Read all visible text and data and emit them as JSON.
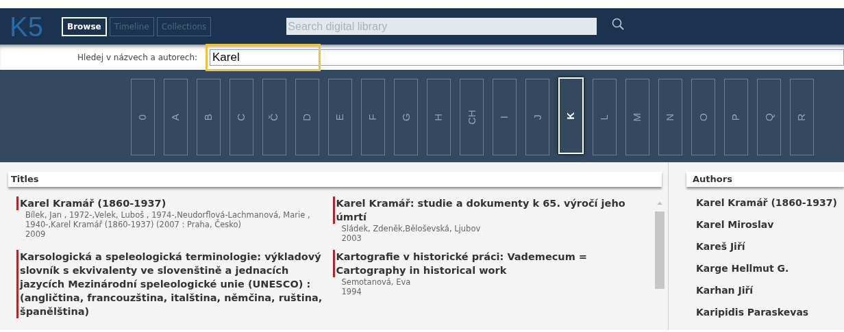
{
  "header": {
    "logo": "K5",
    "tabs": [
      {
        "label": "Browse",
        "selected": true
      },
      {
        "label": "Timeline",
        "selected": false
      },
      {
        "label": "Collections",
        "selected": false
      }
    ],
    "search": {
      "placeholder": "Search digital library"
    }
  },
  "filter": {
    "label": "Hledej v názvech a autorech:",
    "value": "Karel"
  },
  "letters": [
    {
      "label": "0",
      "selected": false
    },
    {
      "label": "A",
      "selected": false
    },
    {
      "label": "B",
      "selected": false
    },
    {
      "label": "C",
      "selected": false
    },
    {
      "label": "Č",
      "selected": false
    },
    {
      "label": "D",
      "selected": false
    },
    {
      "label": "E",
      "selected": false
    },
    {
      "label": "F",
      "selected": false
    },
    {
      "label": "G",
      "selected": false
    },
    {
      "label": "H",
      "selected": false
    },
    {
      "label": "CH",
      "selected": false
    },
    {
      "label": "I",
      "selected": false
    },
    {
      "label": "J",
      "selected": false
    },
    {
      "label": "K",
      "selected": true
    },
    {
      "label": "L",
      "selected": false
    },
    {
      "label": "M",
      "selected": false
    },
    {
      "label": "N",
      "selected": false
    },
    {
      "label": "O",
      "selected": false
    },
    {
      "label": "P",
      "selected": false
    },
    {
      "label": "Q",
      "selected": false
    },
    {
      "label": "R",
      "selected": false
    }
  ],
  "titles": {
    "heading": "Titles",
    "items": [
      {
        "title": "Karel Kramář (1860-1937)",
        "authors": "Bílek, Jan , 1972-,Velek, Luboš , 1974-,Neudorflová-Lachmanová, Marie , 1940-,Karel Kramář (1860-1937) (2007 : Praha, Česko)",
        "year": "2009"
      },
      {
        "title": "Karel Kramář: studie a dokumenty k 65. výročí jeho úmrtí",
        "authors": "Sládek, Zdeněk,Běloševská, Ljubov",
        "year": "2003"
      },
      {
        "title": "Karsologická a speleologická terminologie: výkladový slovník s ekvivalenty ve slovenštině a jednacích jazycích Mezinárodní speleologické unie (UNESCO) : (angličtina, francouzština, italština, němčina, ruština, španělština)"
      },
      {
        "title": "Kartografie v historické práci: Vademecum = Cartography in historical work",
        "authors": "Semotanová, Eva",
        "year": "1994"
      }
    ]
  },
  "authors": {
    "heading": "Authors",
    "items": [
      "Karel Kramář (1860-1937)",
      "Karel Miroslav",
      "Kareš Jiří",
      "Karge Hellmut G.",
      "Karhan Jiří",
      "Karipidis Paraskevas"
    ]
  }
}
